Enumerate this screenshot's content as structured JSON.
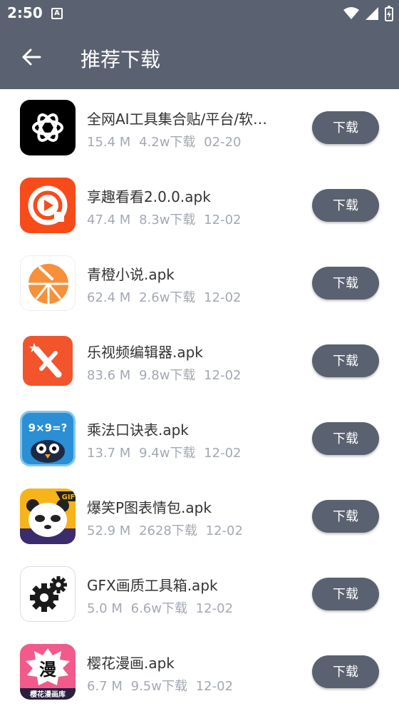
{
  "status": {
    "time": "2:50",
    "notif": "A"
  },
  "appbar": {
    "title": "推荐下载"
  },
  "items": [
    {
      "name": "全网AI工具集合贴/平台/软…",
      "size": "15.4 M",
      "downloads": "4.2w下载",
      "date": "02-20",
      "button": "下载",
      "icon": "chatgpt-icon"
    },
    {
      "name": "享趣看看2.0.0.apk",
      "size": "47.4 M",
      "downloads": "8.3w下载",
      "date": "12-02",
      "button": "下载",
      "icon": "play-icon"
    },
    {
      "name": "青橙小说.apk",
      "size": "62.4 M",
      "downloads": "2.6w下载",
      "date": "12-02",
      "button": "下载",
      "icon": "orange-icon"
    },
    {
      "name": "乐视频编辑器.apk",
      "size": "83.6 M",
      "downloads": "9.8w下载",
      "date": "12-02",
      "button": "下载",
      "icon": "video-editor-icon"
    },
    {
      "name": "乘法口诀表.apk",
      "size": "13.7 M",
      "downloads": "9.4w下载",
      "date": "12-02",
      "button": "下载",
      "icon": "multiplication-icon"
    },
    {
      "name": "爆笑P图表情包.apk",
      "size": "52.9 M",
      "downloads": "2628下载",
      "date": "12-02",
      "button": "下载",
      "icon": "panda-icon"
    },
    {
      "name": "GFX画质工具箱.apk",
      "size": "5.0 M",
      "downloads": "6.6w下载",
      "date": "12-02",
      "button": "下载",
      "icon": "gear-icon"
    },
    {
      "name": "樱花漫画.apk",
      "size": "6.7 M",
      "downloads": "9.5w下载",
      "date": "12-02",
      "button": "下载",
      "icon": "manga-icon"
    }
  ],
  "icon_texts": {
    "mult": "9×9=?",
    "gif": "GIF",
    "manga": "漫",
    "manga_sub": "樱花漫画库"
  }
}
